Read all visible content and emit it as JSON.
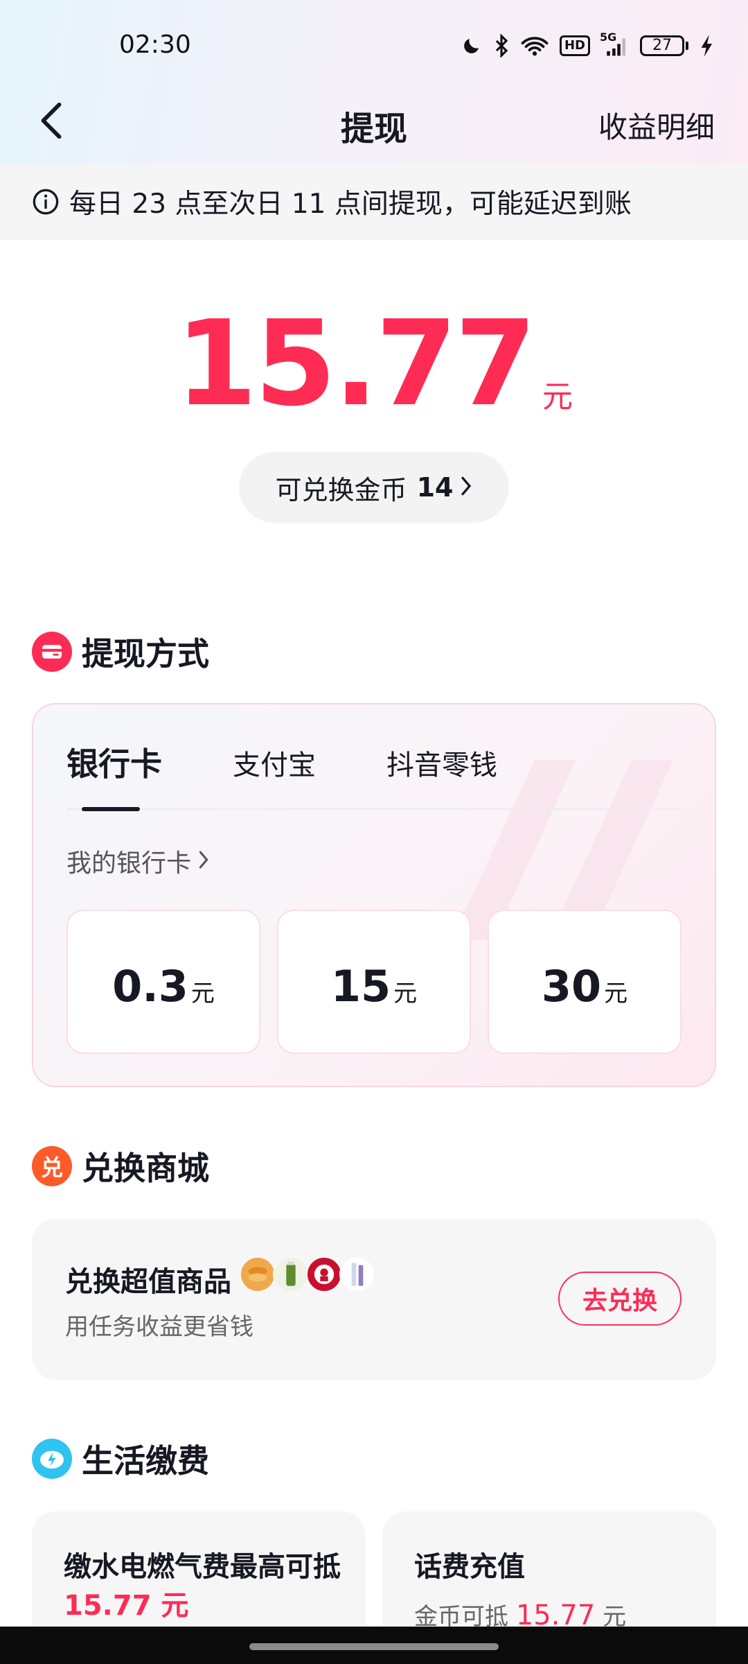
{
  "status_bar": {
    "time": "02:30",
    "network_label": "5G",
    "hd_label": "HD",
    "battery_level": "27",
    "icons": [
      "moon-icon",
      "bluetooth-icon",
      "wifi-icon",
      "hd-icon",
      "signal-icon",
      "battery-icon",
      "charging-icon"
    ]
  },
  "nav": {
    "title": "提现",
    "right_link": "收益明细",
    "back_icon": "chevron-left-icon"
  },
  "notice": {
    "icon": "info-icon",
    "text": "每日 23 点至次日 11 点间提现，可能延迟到账"
  },
  "balance": {
    "amount": "15.77",
    "unit": "元",
    "coin_label": "可兑换金币",
    "coin_count": "14",
    "chevron": "›"
  },
  "withdraw": {
    "section_title": "提现方式",
    "section_icon": "wallet-icon",
    "tabs": [
      {
        "label": "银行卡",
        "active": true
      },
      {
        "label": "支付宝",
        "active": false
      },
      {
        "label": "抖音零钱",
        "active": false
      }
    ],
    "card_link": "我的银行卡",
    "chevron": "›",
    "amounts": [
      {
        "value": "0.3",
        "unit": "元"
      },
      {
        "value": "15",
        "unit": "元"
      },
      {
        "value": "30",
        "unit": "元"
      }
    ]
  },
  "exchange": {
    "section_title": "兑换商城",
    "section_icon": "exchange-icon",
    "section_icon_char": "兑",
    "title": "兑换超值商品",
    "subtitle": "用任务收益更省钱",
    "button": "去兑换",
    "products": [
      "snack-icon",
      "drink-icon",
      "kfc-icon",
      "toothpaste-icon"
    ]
  },
  "bills": {
    "section_title": "生活缴费",
    "section_icon": "bolt-icon",
    "left": {
      "title_prefix": "缴水电燃气费最高可抵",
      "amount": "15.77 元"
    },
    "right": {
      "title": "话费充值",
      "sub_prefix": "金币可抵",
      "amount": "15.77",
      "unit": "元"
    }
  },
  "colors": {
    "accent": "#fe2c55",
    "text": "#161823",
    "muted": "#666666"
  }
}
